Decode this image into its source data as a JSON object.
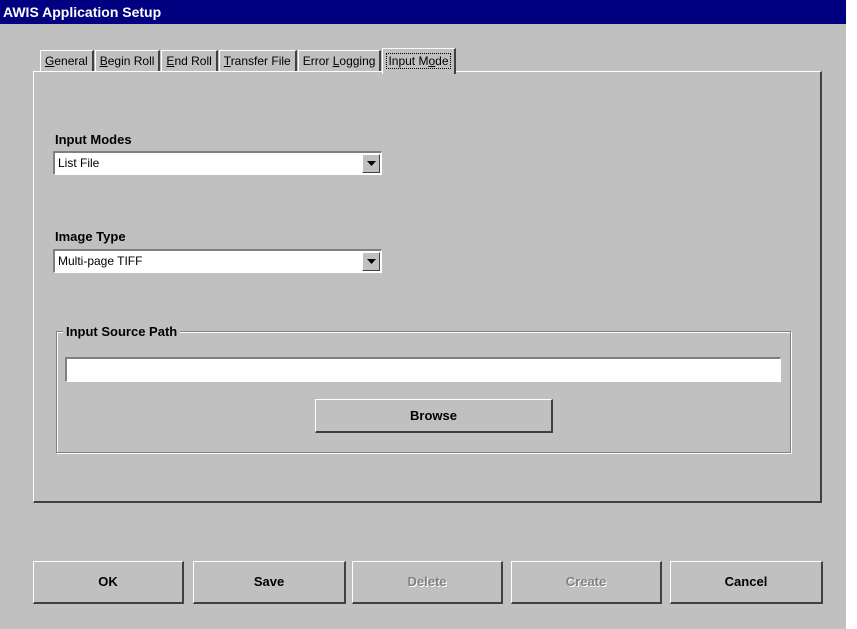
{
  "window": {
    "title": "AWIS Application Setup"
  },
  "tabs": [
    {
      "pre": "",
      "key": "G",
      "post": "eneral"
    },
    {
      "pre": "",
      "key": "B",
      "post": "egin Roll"
    },
    {
      "pre": "",
      "key": "E",
      "post": "nd Roll"
    },
    {
      "pre": "",
      "key": "T",
      "post": "ransfer File"
    },
    {
      "pre": "Error ",
      "key": "L",
      "post": "ogging"
    },
    {
      "pre": "Input M",
      "key": "o",
      "post": "de"
    }
  ],
  "active_tab": "Input Mode",
  "input_modes": {
    "label": "Input Modes",
    "value": "List File"
  },
  "image_type": {
    "label": "Image Type",
    "value": "Multi-page TIFF"
  },
  "input_source": {
    "label": "Input Source Path",
    "value": "",
    "browse_label": "Browse"
  },
  "buttons": {
    "ok": "OK",
    "save": "Save",
    "delete": "Delete",
    "create": "Create",
    "cancel": "Cancel"
  }
}
